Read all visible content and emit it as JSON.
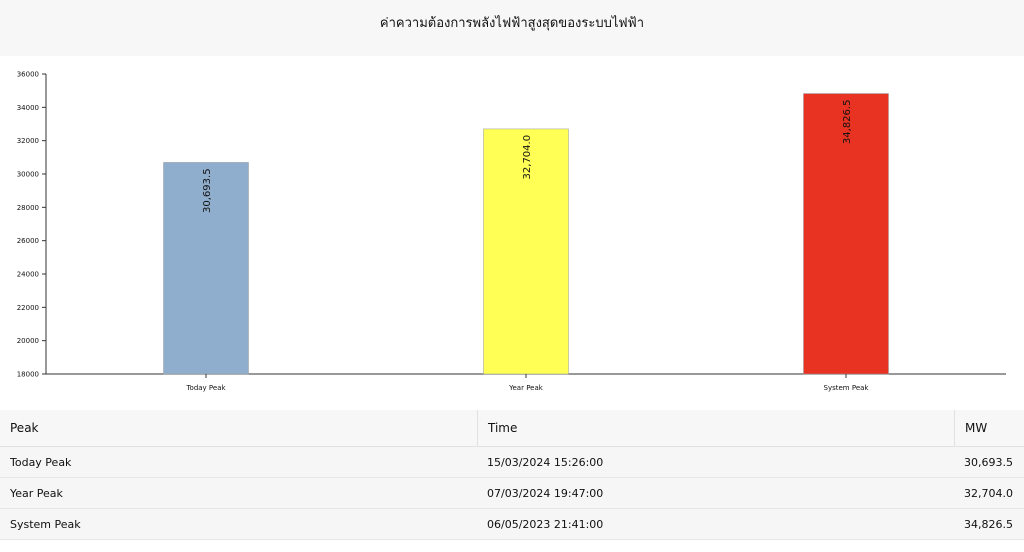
{
  "header": {
    "title": "ค่าความต้องการพลังไฟฟ้าสูงสุดของระบบไฟฟ้า"
  },
  "chart_data": {
    "type": "bar",
    "title": "ค่าความต้องการพลังไฟฟ้าสูงสุดของระบบไฟฟ้า",
    "categories": [
      "Today Peak",
      "Year Peak",
      "System Peak"
    ],
    "values": [
      30693.5,
      32704.0,
      34826.5
    ],
    "data_labels": [
      "30,693.5",
      "32,704.0",
      "34,826.5"
    ],
    "colors": [
      "#8fadcc",
      "#ffff55",
      "#e83323"
    ],
    "ylim": [
      18000,
      36000
    ],
    "yticks": [
      18000,
      20000,
      22000,
      24000,
      26000,
      28000,
      30000,
      32000,
      34000,
      36000
    ],
    "xlabel": "",
    "ylabel": "",
    "grid": false,
    "legend": "none"
  },
  "table": {
    "headers": [
      "Peak",
      "Time",
      "MW"
    ],
    "rows": [
      [
        "Today Peak",
        "15/03/2024  15:26:00",
        "30,693.5"
      ],
      [
        "Year Peak",
        "07/03/2024  19:47:00",
        "32,704.0"
      ],
      [
        "System Peak",
        "06/05/2023  21:41:00",
        "34,826.5"
      ]
    ]
  }
}
